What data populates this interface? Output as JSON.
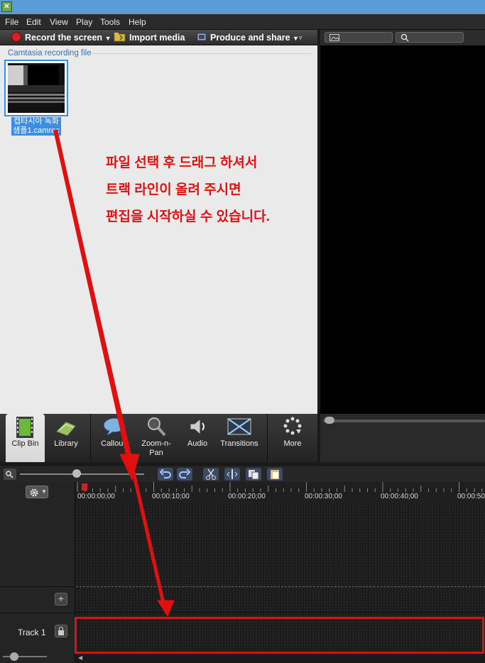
{
  "menu": [
    "File",
    "Edit",
    "View",
    "Play",
    "Tools",
    "Help"
  ],
  "toolbar": {
    "record_label": "Record the screen",
    "import_label": "Import media",
    "produce_label": "Produce and share"
  },
  "clip_bin": {
    "heading": "Camtasia recording file",
    "clip_label_line1": "캡타시아 녹화",
    "clip_label_line2": "샘플1.camrec"
  },
  "annotation": [
    "파일 선택 후 드래그 하셔서",
    "트랙 라인이 올려 주시면",
    "편집을 시작하실 수 있습니다."
  ],
  "tabs": {
    "clip_bin": "Clip Bin",
    "library": "Library",
    "callouts": "Callouts",
    "zoom_pan_1": "Zoom-n-",
    "zoom_pan_2": "Pan",
    "audio": "Audio",
    "transitions": "Transitions",
    "more": "More"
  },
  "timeline": {
    "ticks": [
      "00:00:00;00",
      "00:00:10;00",
      "00:00:20;00",
      "00:00:30;00",
      "00:00:40;00",
      "00:00:50;"
    ],
    "track_label": "Track 1"
  },
  "colors": {
    "accent": "#3a8ee6",
    "annotation": "#e01010",
    "titlebar": "#5a9bd8"
  }
}
